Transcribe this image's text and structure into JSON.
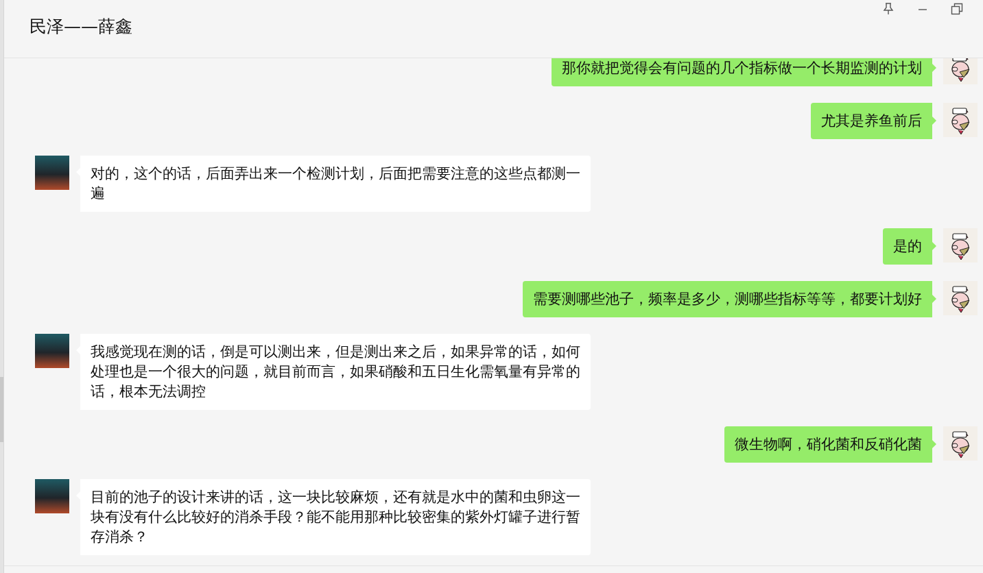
{
  "window": {
    "title": "民泽——薛鑫"
  },
  "messages": [
    {
      "kind": "sent",
      "text": "那你就把觉得会有问题的几个指标做一个长期监测的计划"
    },
    {
      "kind": "sent",
      "text": "尤其是养鱼前后"
    },
    {
      "kind": "received",
      "text": "对的，这个的话，后面弄出来一个检测计划，后面把需要注意的这些点都测一遍"
    },
    {
      "kind": "sent",
      "text": "是的"
    },
    {
      "kind": "sent",
      "text": "需要测哪些池子，频率是多少，测哪些指标等等，都要计划好"
    },
    {
      "kind": "received",
      "text": "我感觉现在测的话，倒是可以测出来，但是测出来之后，如果异常的话，如何处理也是一个很大的问题，就目前而言，如果硝酸和五日生化需氧量有异常的话，根本无法调控"
    },
    {
      "kind": "sent",
      "text": "微生物啊，硝化菌和反硝化菌"
    },
    {
      "kind": "received",
      "text": "目前的池子的设计来讲的话，这一块比较麻烦，还有就是水中的菌和虫卵这一块有没有什么比较好的消杀手段？能不能用那种比较密集的紫外灯罐子进行暂存消杀？"
    }
  ]
}
